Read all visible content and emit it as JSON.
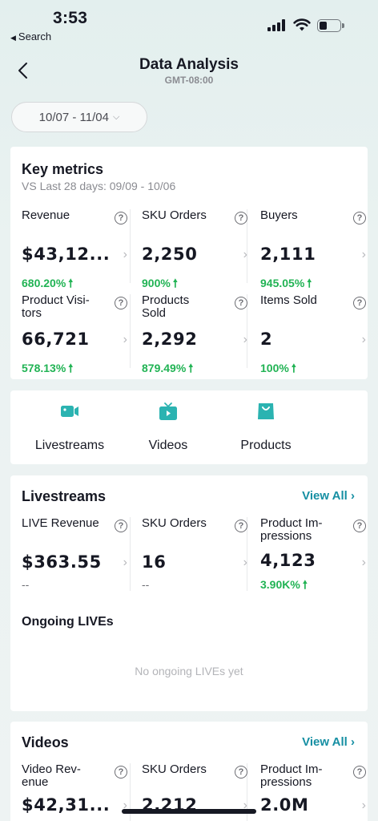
{
  "status_bar": {
    "time": "3:53",
    "back_app": "Search"
  },
  "nav": {
    "title": "Data Analysis",
    "subtitle": "GMT-08:00"
  },
  "date_range": {
    "label": "10/07 - 11/04"
  },
  "key_metrics": {
    "title": "Key metrics",
    "comparison": "VS Last 28 days: 09/09 - 10/06",
    "metrics": [
      {
        "label": "Revenue",
        "value": "$43,12...",
        "delta": "680.20%"
      },
      {
        "label": "SKU Orders",
        "value": "2,250",
        "delta": "900%"
      },
      {
        "label": "Buyers",
        "value": "2,111",
        "delta": "945.05%"
      },
      {
        "label": "Product Visi-\ntors",
        "value": "66,721",
        "delta": "578.13%"
      },
      {
        "label": "Products\nSold",
        "value": "2,292",
        "delta": "879.49%"
      },
      {
        "label": "Items Sold",
        "value": "2",
        "delta": "100%"
      }
    ]
  },
  "tabs": [
    {
      "label": "Livestreams",
      "icon": "video-camera-icon"
    },
    {
      "label": "Videos",
      "icon": "tv-play-icon"
    },
    {
      "label": "Products",
      "icon": "shopping-bag-icon"
    }
  ],
  "livestreams": {
    "title": "Livestreams",
    "view_all": "View All",
    "metrics": [
      {
        "label": "LIVE Revenue",
        "value": "$363.55",
        "delta": "--"
      },
      {
        "label": "SKU Orders",
        "value": "16",
        "delta": "--"
      },
      {
        "label": "Product Im-\npressions",
        "value": "4,123",
        "delta": "3.90K%"
      }
    ],
    "ongoing_title": "Ongoing LIVEs",
    "ongoing_empty": "No ongoing LIVEs yet"
  },
  "videos": {
    "title": "Videos",
    "view_all": "View All",
    "metrics": [
      {
        "label": "Video Rev-\nenue",
        "value": "$42,31..."
      },
      {
        "label": "SKU Orders",
        "value": "2,212"
      },
      {
        "label": "Product Im-\npressions",
        "value": "2.0M"
      }
    ]
  },
  "colors": {
    "accent": "#168fa3",
    "positive": "#21b354",
    "icon_teal": "#2bb3b1"
  }
}
